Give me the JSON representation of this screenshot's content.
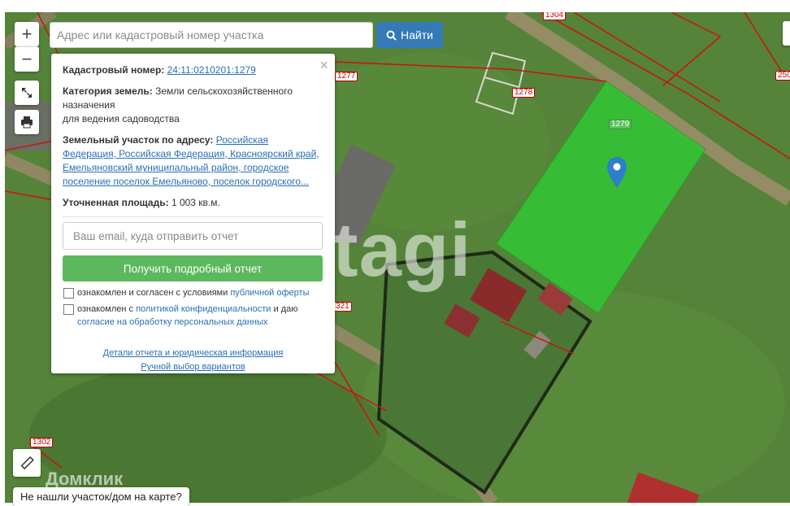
{
  "map_controls": {
    "zoom_in": "+",
    "zoom_out": "−"
  },
  "search": {
    "placeholder": "Адрес или кадастровый номер участка",
    "button_label": "Найти"
  },
  "popup": {
    "cadastral_label": "Кадастровый номер:",
    "cadastral_value": "24:11:0210201:1279",
    "category_label": "Категория земель:",
    "category_value": "Земли сельскохозяйственного назначения",
    "category_extra": "для ведения садоводства",
    "address_label": "Земельный участок по адресу:",
    "address_value": "Российская Федерация, Российская Федерация, Красноярский край, Емельяновский муниципальный район, городское поселение поселок Емельяново, поселок городского...",
    "area_label": "Уточненная площадь:",
    "area_value": "1 003 кв.м.",
    "email_placeholder": "Ваш email, куда отправить отчет",
    "report_button": "Получить подробный отчет",
    "consent1_text": "ознакомлен и согласен с условиями ",
    "consent1_link": "публичной оферты",
    "consent2_text": "ознакомлен с ",
    "consent2_link": "политикой конфиденциальности",
    "consent2_mid": " и даю ",
    "consent2_link2": "согласие на обработку персональных данных",
    "details_link": "Детали отчета и юридическая информация",
    "manual_link": "Ручной выбор вариантов"
  },
  "parcel_labels": {
    "l1304": "1304",
    "l1277": "1277",
    "l1278": "1278",
    "l1279": "1279",
    "l250": "250",
    "l321": "321",
    "l1302": "1302"
  },
  "watermarks": {
    "tagi": "etagi",
    "domclick": "Домклик"
  },
  "missing_button": "Не нашли участок/дом на карте?",
  "colors": {
    "accent": "#337ab7",
    "success": "#5cb85c",
    "selected_parcel": "#35c235",
    "boundary": "#d01010"
  }
}
